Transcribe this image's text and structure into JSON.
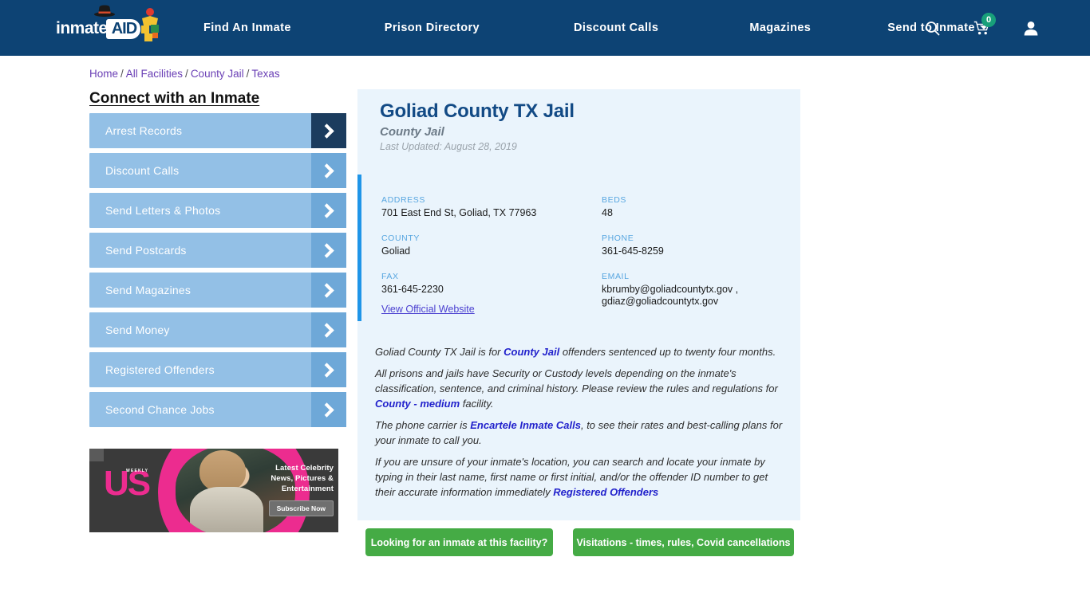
{
  "colors": {
    "nav_bg": "#0d4374",
    "sidebar_item": "#93c0e6",
    "sidebar_chevron": "#6ea8d8",
    "sidebar_chevron_active": "#1b3c5e",
    "card_bg": "#eaf4fc",
    "accent_bar": "#1f95e8",
    "green_button": "#45ab45",
    "cart_badge": "#18a07a",
    "link": "#2222cc",
    "breadcrumb_link": "#6a3fb5"
  },
  "header": {
    "logo_text": "inmate",
    "logo_badge": "AID",
    "nav": [
      {
        "label": "Find An Inmate"
      },
      {
        "label": "Prison Directory"
      },
      {
        "label": "Discount Calls"
      },
      {
        "label": "Magazines"
      },
      {
        "label": "Send to Inmate"
      }
    ],
    "icons": {
      "search": "search-icon",
      "cart": "cart-icon",
      "cart_count": "0",
      "account": "user-icon"
    }
  },
  "breadcrumb": {
    "items": [
      "Home",
      "All Facilities",
      "County Jail",
      "Texas"
    ],
    "separator": "/"
  },
  "sidebar": {
    "title": "Connect with an Inmate",
    "items": [
      {
        "label": "Arrest Records"
      },
      {
        "label": "Discount Calls"
      },
      {
        "label": "Send Letters & Photos"
      },
      {
        "label": "Send Postcards"
      },
      {
        "label": "Send Magazines"
      },
      {
        "label": "Send Money"
      },
      {
        "label": "Registered Offenders"
      },
      {
        "label": "Second Chance Jobs"
      }
    ]
  },
  "ad": {
    "brand": "US",
    "brand_sub": "WEEKLY",
    "lines": [
      "Latest Celebrity",
      "News, Pictures &",
      "Entertainment"
    ],
    "button": "Subscribe Now"
  },
  "facility": {
    "title": "Goliad County TX Jail",
    "type": "County Jail",
    "last_updated": "Last Updated: August 28, 2019",
    "fields": {
      "address_label": "ADDRESS",
      "address_value": "701 East End St, Goliad, TX 77963",
      "beds_label": "BEDS",
      "beds_value": "48",
      "county_label": "COUNTY",
      "county_value": "Goliad",
      "phone_label": "PHONE",
      "phone_value": "361-645-8259",
      "fax_label": "FAX",
      "fax_value": "361-645-2230",
      "email_label": "EMAIL",
      "email_value_1": "kbrumby@goliadcountytx.gov ,",
      "email_value_2": "gdiaz@goliadcountytx.gov"
    },
    "official_website": "View Official Website"
  },
  "description": {
    "p1_before": "Goliad County TX Jail is for ",
    "p1_link": "County Jail",
    "p1_after": " offenders sentenced up to twenty four months.",
    "p2_before": "All prisons and jails have Security or Custody levels depending on the inmate's classification, sentence, and criminal history. Please review the rules and regulations for ",
    "p2_link": "County - medium",
    "p2_after": " facility.",
    "p3_before": "The phone carrier is ",
    "p3_link": "Encartele Inmate Calls",
    "p3_after": ", to see their rates and best-calling plans for your inmate to call you.",
    "p4_before": "If you are unsure of your inmate's location, you can search and locate your inmate by typing in their last name, first name or first initial, and/or the offender ID number to get their accurate information immediately ",
    "p4_link": "Registered Offenders"
  },
  "actions": {
    "find_inmate": "Looking for an inmate at this facility?",
    "visitations": "Visitations - times, rules, Covid cancellations"
  }
}
